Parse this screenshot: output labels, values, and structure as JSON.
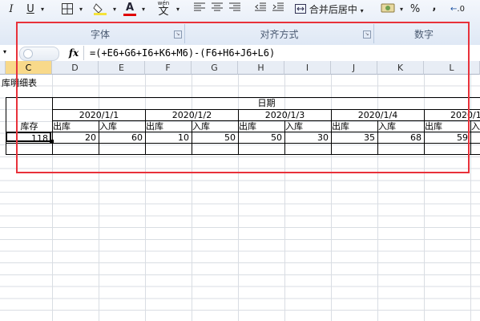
{
  "ribbon": {
    "italic_label": "I",
    "underline_label": "U",
    "wen_label": "wén",
    "wen_char": "文",
    "merge_center_label": "合并后居中",
    "percent_label": "%",
    "comma_label": ",",
    "decimal_label": ".0",
    "groups": {
      "font": "字体",
      "alignment": "对齐方式",
      "number": "数字"
    },
    "font_color_hex": "#e00000",
    "fill_color_hex": "#f5e33a"
  },
  "formula_bar": {
    "fx_label": "fx",
    "formula": "=(+E6+G6+I6+K6+M6)-(F6+H6+J6+L6)"
  },
  "columns": [
    "C",
    "D",
    "E",
    "F",
    "G",
    "H",
    "I",
    "J",
    "K",
    "L"
  ],
  "selected_column": "C",
  "sheet": {
    "title": "库明细表",
    "date_header": "日期",
    "dates": [
      "2020/1/1",
      "2020/1/2",
      "2020/1/3",
      "2020/1/4",
      "2020/1"
    ],
    "stock_label": "库存",
    "out_label": "出库",
    "in_label": "入库",
    "row_values": {
      "C": "118",
      "D": "20",
      "E": "60",
      "F": "10",
      "G": "50",
      "H": "50",
      "I": "30",
      "J": "35",
      "K": "68",
      "L": "59"
    }
  }
}
